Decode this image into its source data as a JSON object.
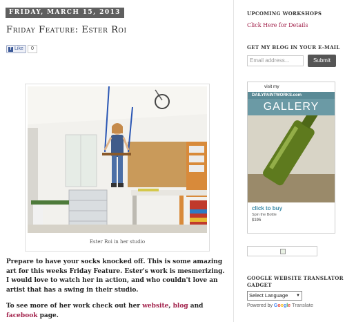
{
  "post": {
    "date": "FRIDAY, MARCH 15, 2013",
    "title": "Friday Feature: Ester Roi",
    "fb_like_label": "Like",
    "fb_like_count": "0",
    "photo_caption": "Ester Roi in her studio",
    "paragraph1": "Prepare to have your socks knocked off.  This is some amazing art for this weeks Friday Feature.  Ester's work is mesmerizing.  I would love to watch her in action, and who couldn't love an artist that has a swing in their studio.",
    "paragraph2_prefix": "To see more of her work check out her ",
    "link_website": "website",
    "sep_comma": ", ",
    "link_blog": "blog",
    "sep_and": " and ",
    "link_facebook": "facebook",
    "paragraph2_suffix": " page."
  },
  "sidebar": {
    "workshops_heading": "UPCOMING WORKSHOPS",
    "workshops_link": "Click Here for Details",
    "email_heading": "GET MY BLOG IN YOUR E-MAIL",
    "email_placeholder": "Email address...",
    "submit_label": "Submit",
    "ad": {
      "visit": "visit my",
      "site": "DAILYPAINTWORKS.com",
      "gallery": "GALLERY",
      "buy": "click to buy",
      "painting_title": "Spin the Bottle",
      "price": "$195"
    },
    "translator_heading_line1": "GOOGLE WEBSITE TRANSLATOR",
    "translator_heading_line2": "GADGET",
    "select_label": "Select Language",
    "select_arrow": "▼",
    "powered_by": "Powered by ",
    "google_letters": [
      "G",
      "o",
      "o",
      "g",
      "l",
      "e"
    ],
    "translate_label": " Translate"
  },
  "colors": {
    "link": "#a1204a",
    "date_bg": "#5f5f5f",
    "submit_bg": "#555555",
    "ad_teal": "#6b9aa5"
  }
}
